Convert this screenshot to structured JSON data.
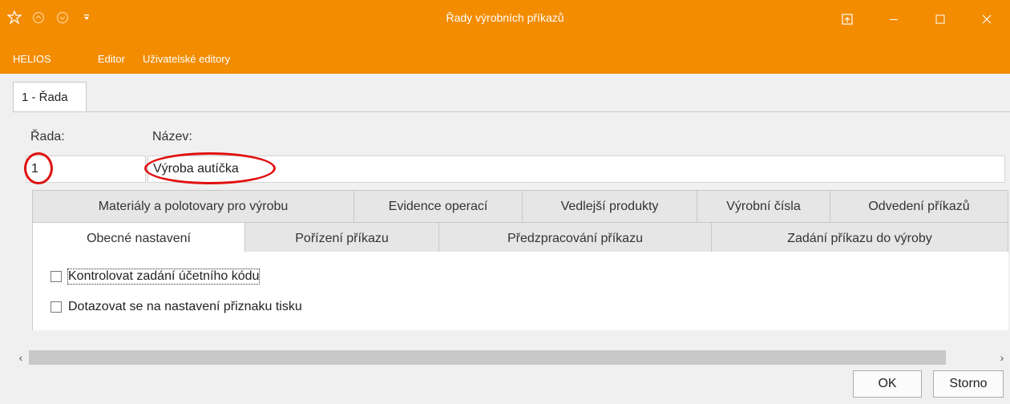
{
  "window": {
    "title": "Řady výrobních příkazů"
  },
  "menu": {
    "items": [
      "HELIOS",
      "Editor",
      "Uživatelské editory"
    ]
  },
  "doc_tab": {
    "label": "1 - Řada"
  },
  "form": {
    "rada_label": "Řada:",
    "rada_value": "1",
    "nazev_label": "Název:",
    "nazev_value": "Výroba autíčka"
  },
  "tabs": {
    "row1": [
      {
        "label": "Materiály a polotovary pro výrobu"
      },
      {
        "label": "Evidence operací"
      },
      {
        "label": "Vedlejší produkty"
      },
      {
        "label": "Výrobní čísla"
      },
      {
        "label": "Odvedení příkazů"
      }
    ],
    "row2": [
      {
        "label": "Obecné nastavení",
        "active": true
      },
      {
        "label": "Pořízení příkazu"
      },
      {
        "label": "Předzpracování příkazu"
      },
      {
        "label": "Zadání příkazu do výroby"
      }
    ]
  },
  "options": [
    {
      "label": "Kontrolovat zadání účetního kódu",
      "checked": false,
      "focused": true
    },
    {
      "label": "Dotazovat se na nastavení přiznaku tisku",
      "checked": false
    }
  ],
  "buttons": {
    "ok": "OK",
    "cancel": "Storno"
  },
  "colors": {
    "accent": "#f38c00",
    "annotation": "#e01010"
  }
}
